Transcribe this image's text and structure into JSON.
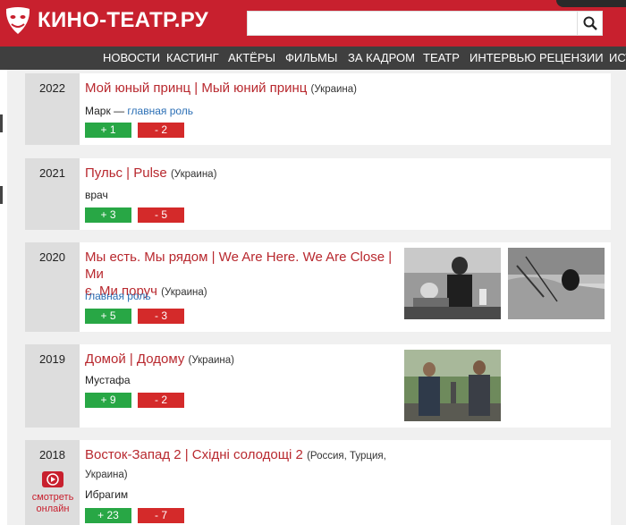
{
  "site": {
    "logo_text": "КИНО-ТЕАТР.РУ"
  },
  "search": {
    "value": "",
    "placeholder": ""
  },
  "nav": [
    "НОВОСТИ",
    "КАСТИНГ",
    "АКТЁРЫ",
    "ФИЛЬМЫ",
    "ЗА КАДРОМ",
    "ТЕАТР",
    "ИНТЕРВЬЮ",
    "РЕЦЕНЗИИ",
    "ИСТ"
  ],
  "films": [
    {
      "year": "2022",
      "title": "Мой юный принц | Мый юний принц",
      "country": "(Украина)",
      "role": "Марк —",
      "role_link": "главная роль",
      "votes_up": "+ 1",
      "votes_down": "- 2"
    },
    {
      "year": "2021",
      "title": "Пульс | Pulse",
      "country": "(Украина)",
      "role": "врач",
      "votes_up": "+ 3",
      "votes_down": "- 5"
    },
    {
      "year": "2020",
      "title_line1": "Мы есть. Мы рядом | We Are Here. We Are Close | Ми",
      "title_line2": "є. Ми поруч",
      "country": "(Украина)",
      "role_link": "главная роль",
      "votes_up": "+ 5",
      "votes_down": "- 3"
    },
    {
      "year": "2019",
      "title": "Домой | Додому",
      "country": "(Украина)",
      "role": "Мустафа",
      "votes_up": "+ 9",
      "votes_down": "- 2"
    },
    {
      "year": "2018",
      "title": "Восток-Запад 2 | Східні солодощі 2",
      "country_line1": "(Россия, Турция,",
      "country_line2": "Украина)",
      "role": "Ибрагим",
      "votes_up": "+ 23",
      "votes_down": "- 7",
      "watch_line1": "смотреть",
      "watch_line2": "онлайн"
    }
  ],
  "colors": {
    "brand_red": "#c8202e",
    "nav_bg": "#3f3f3f",
    "vote_up": "#28a745",
    "vote_down": "#d42a2a",
    "title_red": "#b8282e",
    "link_blue": "#2b6fb5"
  },
  "icons": [
    "theatre-mask-icon",
    "search-icon",
    "play-icon"
  ]
}
